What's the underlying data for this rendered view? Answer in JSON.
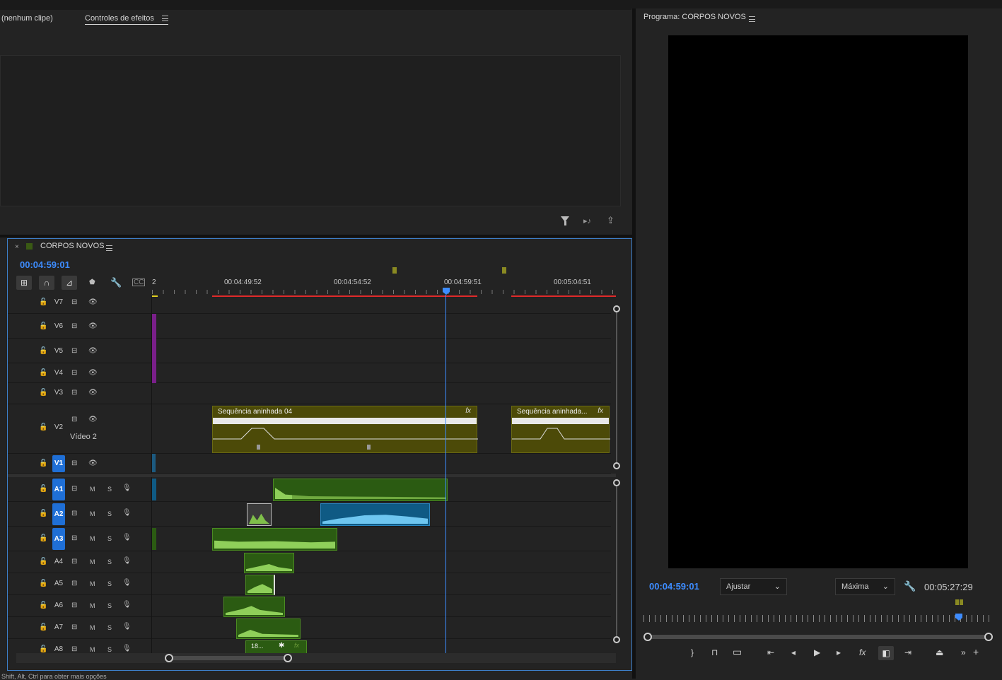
{
  "effect_panel": {
    "source_tab": "(nenhum clipe)",
    "effects_tab": "Controles de efeitos"
  },
  "program_monitor": {
    "title": "Programa: CORPOS NOVOS",
    "timecode_current": "00:04:59:01",
    "timecode_duration": "00:05:27:29",
    "fit_option": "Ajustar",
    "quality_option": "Máxima"
  },
  "timeline": {
    "sequence_name": "CORPOS NOVOS",
    "timecode": "00:04:59:01",
    "ruler_labels": [
      "2",
      "00:04:49:52",
      "00:04:54:52",
      "00:04:59:51",
      "00:05:04:51"
    ],
    "video_tracks": [
      {
        "name": "V7",
        "targeted": false
      },
      {
        "name": "V6",
        "targeted": false
      },
      {
        "name": "V5",
        "targeted": false
      },
      {
        "name": "V4",
        "targeted": false
      },
      {
        "name": "V3",
        "targeted": false
      },
      {
        "name": "V2",
        "targeted": false,
        "label": "Vídeo 2"
      },
      {
        "name": "V1",
        "targeted": true
      }
    ],
    "audio_tracks": [
      {
        "name": "A1",
        "targeted": true,
        "m": "M",
        "s": "S"
      },
      {
        "name": "A2",
        "targeted": true,
        "m": "M",
        "s": "S"
      },
      {
        "name": "A3",
        "targeted": true,
        "m": "M",
        "s": "S"
      },
      {
        "name": "A4",
        "targeted": false,
        "m": "M",
        "s": "S"
      },
      {
        "name": "A5",
        "targeted": false,
        "m": "M",
        "s": "S"
      },
      {
        "name": "A6",
        "targeted": false,
        "m": "M",
        "s": "S"
      },
      {
        "name": "A7",
        "targeted": false,
        "m": "M",
        "s": "S"
      },
      {
        "name": "A8",
        "targeted": false,
        "m": "M",
        "s": "S"
      }
    ],
    "video_clips": [
      {
        "label": "Sequência aninhada 04",
        "fx": "fx"
      },
      {
        "label": "Sequência aninhada...",
        "fx": "fx"
      }
    ],
    "audio_clip_label": "18...",
    "audio_clip_fx": "fx"
  },
  "status_bar": {
    "hint": "Shift, Alt, Ctrl para obter mais opções"
  },
  "colors": {
    "accent_blue": "#3d8cff",
    "video_clip": "#4c4a08",
    "audio_clip": "#2b5b12",
    "selected_audio_clip": "#0f5a84",
    "track_target": "#1f6fd6",
    "work_area_red": "#e02a2a"
  }
}
